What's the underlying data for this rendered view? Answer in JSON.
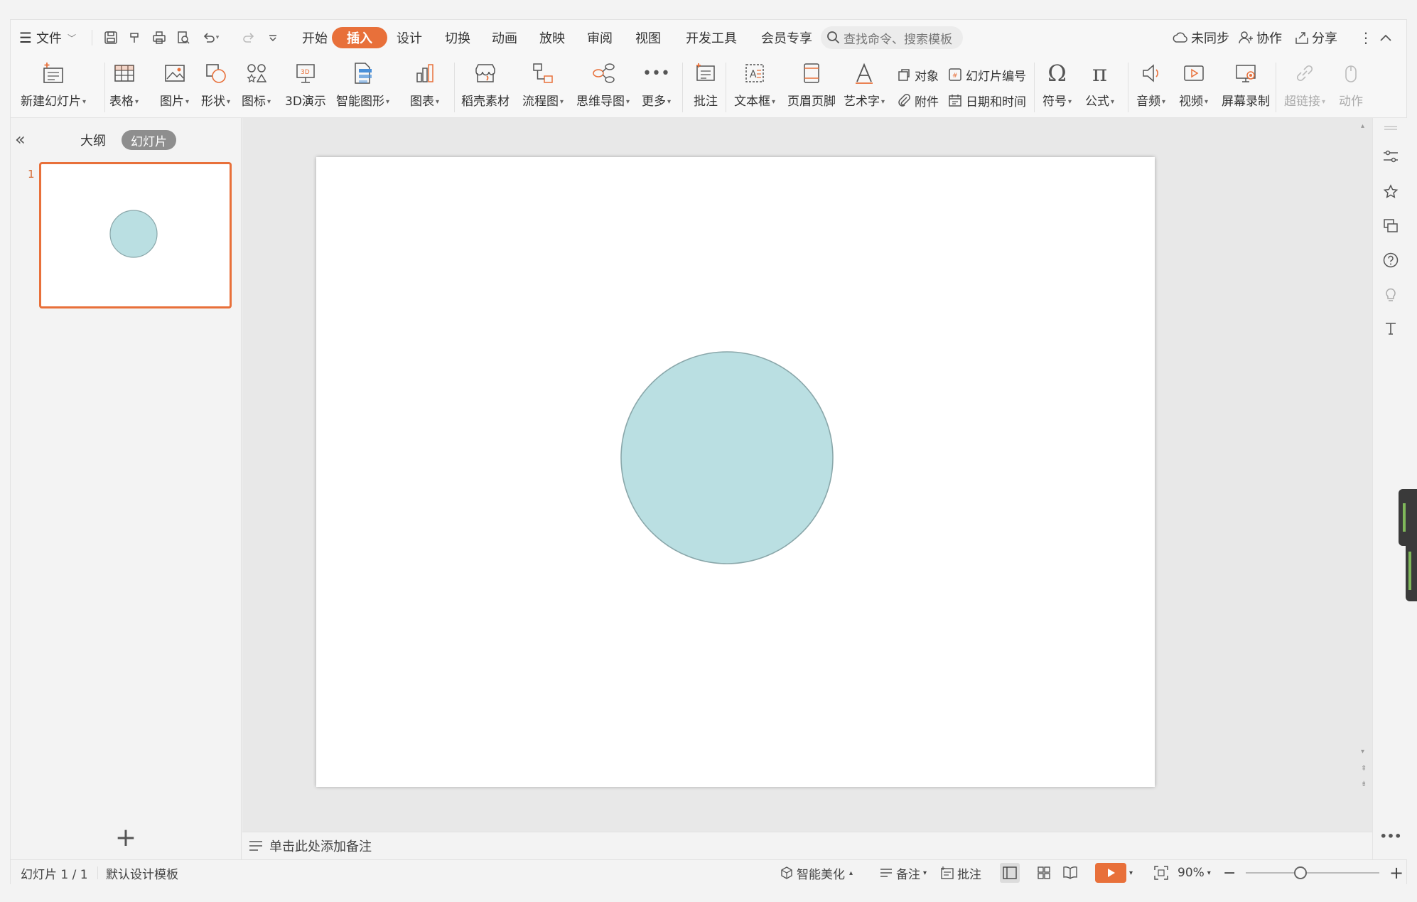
{
  "menu": {
    "file_label": "文件",
    "tabs": [
      "开始",
      "插入",
      "设计",
      "切换",
      "动画",
      "放映",
      "审阅",
      "视图",
      "开发工具",
      "会员专享"
    ],
    "active_tab_index": 1,
    "search_placeholder": "查找命令、搜索模板",
    "sync_label": "未同步",
    "collab_label": "协作",
    "share_label": "分享"
  },
  "ribbon": {
    "new_slide": "新建幻灯片",
    "table": "表格",
    "picture": "图片",
    "shape": "形状",
    "icon": "图标",
    "demo3d": "3D演示",
    "smartart": "智能图形",
    "chart": "图表",
    "docer": "稻壳素材",
    "flowchart": "流程图",
    "mindmap": "思维导图",
    "more": "更多",
    "comment": "批注",
    "textbox": "文本框",
    "header_footer": "页眉页脚",
    "wordart": "艺术字",
    "object": "对象",
    "slide_number": "幻灯片编号",
    "attachment": "附件",
    "datetime": "日期和时间",
    "symbol": "符号",
    "formula": "公式",
    "audio": "音频",
    "video": "视频",
    "screen_record": "屏幕录制",
    "hyperlink": "超链接",
    "action": "动作"
  },
  "panel": {
    "outline_tab": "大纲",
    "slides_tab": "幻灯片",
    "slide_number": "1",
    "add_slide": "+"
  },
  "slide": {
    "circle_fill": "#badfe2",
    "circle_stroke": "#8aa7aa"
  },
  "notes_placeholder": "单击此处添加备注",
  "status": {
    "slide_counter": "幻灯片 1 / 1",
    "template": "默认设计模板",
    "beautify": "智能美化",
    "notes": "备注",
    "comments": "批注",
    "zoom": "90%"
  },
  "colors": {
    "accent": "#e8703a",
    "active_tab_text": "#ffffff"
  }
}
